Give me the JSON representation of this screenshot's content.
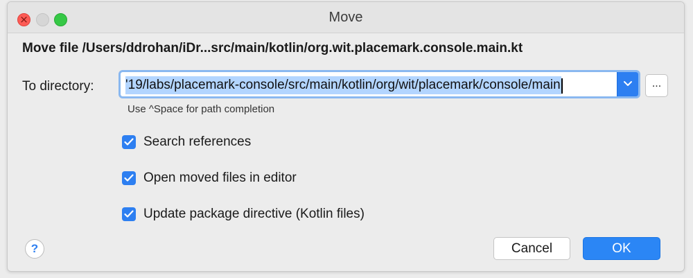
{
  "window": {
    "title": "Move"
  },
  "dialog": {
    "heading": "Move file /Users/ddrohan/iDr...src/main/kotlin/org.wit.placemark.console.main.kt",
    "directory_label": "To directory:",
    "directory_value": "'19/labs/placemark-console/src/main/kotlin/org/wit/placemark/console/main",
    "browse_label": "...",
    "hint": "Use ^Space for path completion",
    "options": [
      {
        "label": "Search references",
        "checked": true
      },
      {
        "label": "Open moved files in editor",
        "checked": true
      },
      {
        "label": "Update package directive (Kotlin files)",
        "checked": true
      }
    ],
    "help_label": "?",
    "cancel_label": "Cancel",
    "ok_label": "OK"
  },
  "colors": {
    "accent": "#2d7ff1",
    "selection": "#b3d5ff",
    "close": "#fd5b55",
    "maximize": "#36c846"
  },
  "icons": {
    "dropdown": "chevron-down-icon",
    "checkbox": "checkmark-icon"
  }
}
